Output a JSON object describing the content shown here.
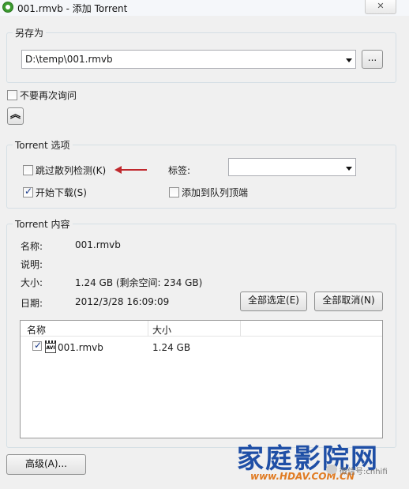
{
  "window": {
    "title": "001.rmvb - 添加 Torrent"
  },
  "save_as": {
    "legend": "另存为",
    "path": "D:\\temp\\001.rmvb",
    "browse_label": "..."
  },
  "dont_ask_label": "不要再次询问",
  "collapse_glyph": "≈",
  "torrent_options": {
    "legend": "Torrent 选项",
    "skip_hash_label": "跳过散列检测(K)",
    "skip_hash_checked": false,
    "start_download_label": "开始下载(S)",
    "start_download_checked": true,
    "tag_label": "标签:",
    "tag_value": "",
    "add_to_top_label": "添加到队列顶端",
    "add_to_top_checked": false
  },
  "torrent_content": {
    "legend": "Torrent 内容",
    "name_label": "名称:",
    "name_value": "001.rmvb",
    "desc_label": "说明:",
    "desc_value": "",
    "size_label": "大小:",
    "size_value": "1.24 GB (剩余空间: 234 GB)",
    "date_label": "日期:",
    "date_value": "2012/3/28 16:09:09",
    "select_all_label": "全部选定(E)",
    "deselect_all_label": "全部取消(N)",
    "file_list": {
      "columns": [
        "名称",
        "大小"
      ],
      "rows": [
        {
          "name": "001.rmvb",
          "size": "1.24 GB",
          "checked": true,
          "icon_text": "AVI"
        }
      ]
    }
  },
  "advanced_label": "高级(A)...",
  "watermark": {
    "brand": "家庭影院网",
    "url": "www.HDAV.COM.CN",
    "wechat": "微信号:cnhifi"
  },
  "colors": {
    "annotation_arrow": "#c0282d",
    "brand_blue": "#1f4fa6",
    "brand_orange": "#e07b22"
  }
}
